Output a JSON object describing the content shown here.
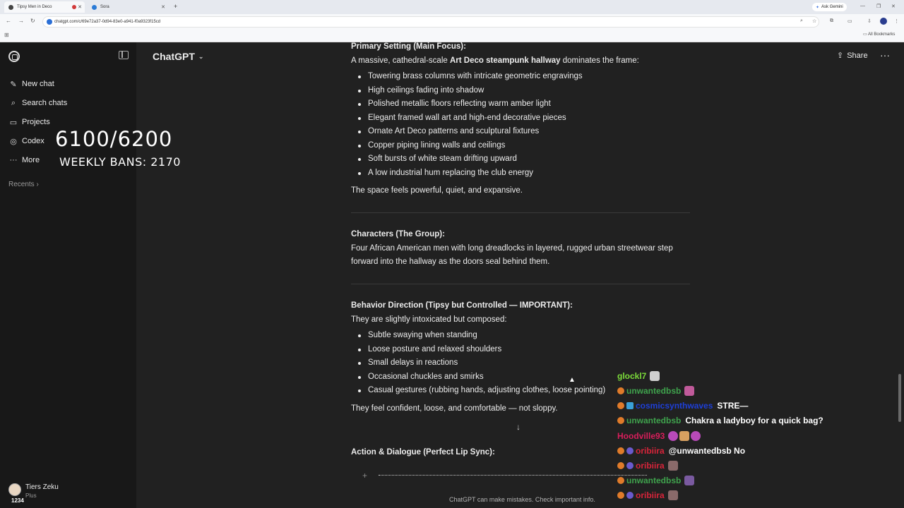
{
  "browser": {
    "tabs": [
      {
        "label": "Tipsy Men in Deco"
      },
      {
        "label": "Sora"
      }
    ],
    "new_tab": "+",
    "ask_gemini": "Ask Gemini",
    "url": "chatgpt.com/c/69e72a37-0d94-83e0-a941-f0a9323f15cd",
    "all_bookmarks": "All Bookmarks"
  },
  "sidebar": {
    "items": [
      {
        "label": "New chat",
        "icon": "edit-icon"
      },
      {
        "label": "Search chats",
        "icon": "search-icon"
      },
      {
        "label": "Projects",
        "icon": "folder-icon"
      },
      {
        "label": "Codex",
        "icon": "codex-icon"
      },
      {
        "label": "More",
        "icon": "dots-icon"
      }
    ],
    "recents": "Recents",
    "user": {
      "name": "Tiers Zeku",
      "plan": "Plus",
      "badge": "1234"
    }
  },
  "overlay": {
    "count": "6100/6200",
    "bans": "WEEKLY BANS: 2170"
  },
  "header": {
    "title": "ChatGPT",
    "share": "Share"
  },
  "message": {
    "s1_title": "Primary Setting (Main Focus):",
    "s1_intro_pre": "A massive, cathedral-scale ",
    "s1_intro_bold": "Art Deco steampunk hallway",
    "s1_intro_post": " dominates the frame:",
    "s1_bullets": [
      "Towering brass columns with intricate geometric engravings",
      "High ceilings fading into shadow",
      "Polished metallic floors reflecting warm amber light",
      "Elegant framed wall art and high-end decorative pieces",
      "Ornate Art Deco patterns and sculptural fixtures",
      "Copper piping lining walls and ceilings",
      "Soft bursts of white steam drifting upward",
      "A low industrial hum replacing the club energy"
    ],
    "s1_closing": "The space feels powerful, quiet, and expansive.",
    "s2_title": "Characters (The Group):",
    "s2_line1": "Four African American men with long dreadlocks in layered, rugged urban streetwear step",
    "s2_line2": "forward into the hallway as the doors seal behind them.",
    "s3_title": "Behavior Direction (Tipsy but Controlled — IMPORTANT):",
    "s3_intro": "They are slightly intoxicated but composed:",
    "s3_bullets": [
      "Subtle swaying when standing",
      "Loose posture and relaxed shoulders",
      "Small delays in reactions",
      "Occasional chuckles and smirks",
      "Casual gestures (rubbing hands, adjusting clothes, loose pointing)"
    ],
    "s3_closing": "They feel confident, loose, and comfortable — not sloppy.",
    "s4_title": "Action & Dialogue (Perfect Lip Sync):"
  },
  "composer": {
    "disclaimer": "ChatGPT can make mistakes. Check important info."
  },
  "chat_overlay": [
    {
      "user": "glockl7",
      "color": "#7cdc3a",
      "msg": ""
    },
    {
      "user": "unwantedbsb",
      "color": "#3fa34d",
      "msg": ""
    },
    {
      "user": "cosmicsynthwaves",
      "color": "#1e3fd8",
      "msg": "STRE—"
    },
    {
      "user": "unwantedbsb",
      "color": "#3fa34d",
      "msg": "Chakra a ladyboy for a quick bag?"
    },
    {
      "user": "Hoodville93",
      "color": "#d81e5b",
      "msg": ""
    },
    {
      "user": "oribiira",
      "color": "#d8243a",
      "msg": "@unwantedbsb No"
    },
    {
      "user": "oribiira",
      "color": "#d8243a",
      "msg": ""
    },
    {
      "user": "unwantedbsb",
      "color": "#3fa34d",
      "msg": ""
    },
    {
      "user": "oribiira",
      "color": "#d8243a",
      "msg": ""
    }
  ]
}
